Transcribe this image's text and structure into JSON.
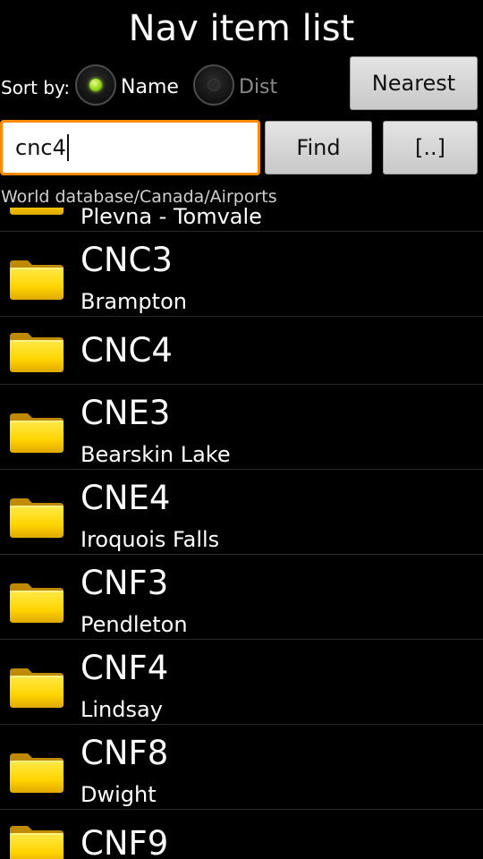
{
  "header": {
    "title": "Nav item list"
  },
  "sort": {
    "label": "Sort by:",
    "options": [
      {
        "label": "Name",
        "selected": true
      },
      {
        "label": "Dist",
        "selected": false
      }
    ]
  },
  "buttons": {
    "nearest": "Nearest",
    "find": "Find",
    "up": "[..]"
  },
  "search": {
    "value": "cnc4"
  },
  "path": "World database/Canada/Airports",
  "colors": {
    "accent": "#ff8a00",
    "folder": "#ffd400",
    "radio_selected": "#8fd313"
  },
  "items": [
    {
      "ident": "",
      "name": "Plevna - Tomvale"
    },
    {
      "ident": "CNC3",
      "name": "Brampton"
    },
    {
      "ident": "CNC4",
      "name": ""
    },
    {
      "ident": "CNE3",
      "name": "Bearskin Lake"
    },
    {
      "ident": "CNE4",
      "name": "Iroquois Falls"
    },
    {
      "ident": "CNF3",
      "name": "Pendleton"
    },
    {
      "ident": "CNF4",
      "name": "Lindsay"
    },
    {
      "ident": "CNF8",
      "name": "Dwight"
    },
    {
      "ident": "CNF9",
      "name": ""
    }
  ],
  "icons": {
    "item": "folder-icon"
  }
}
